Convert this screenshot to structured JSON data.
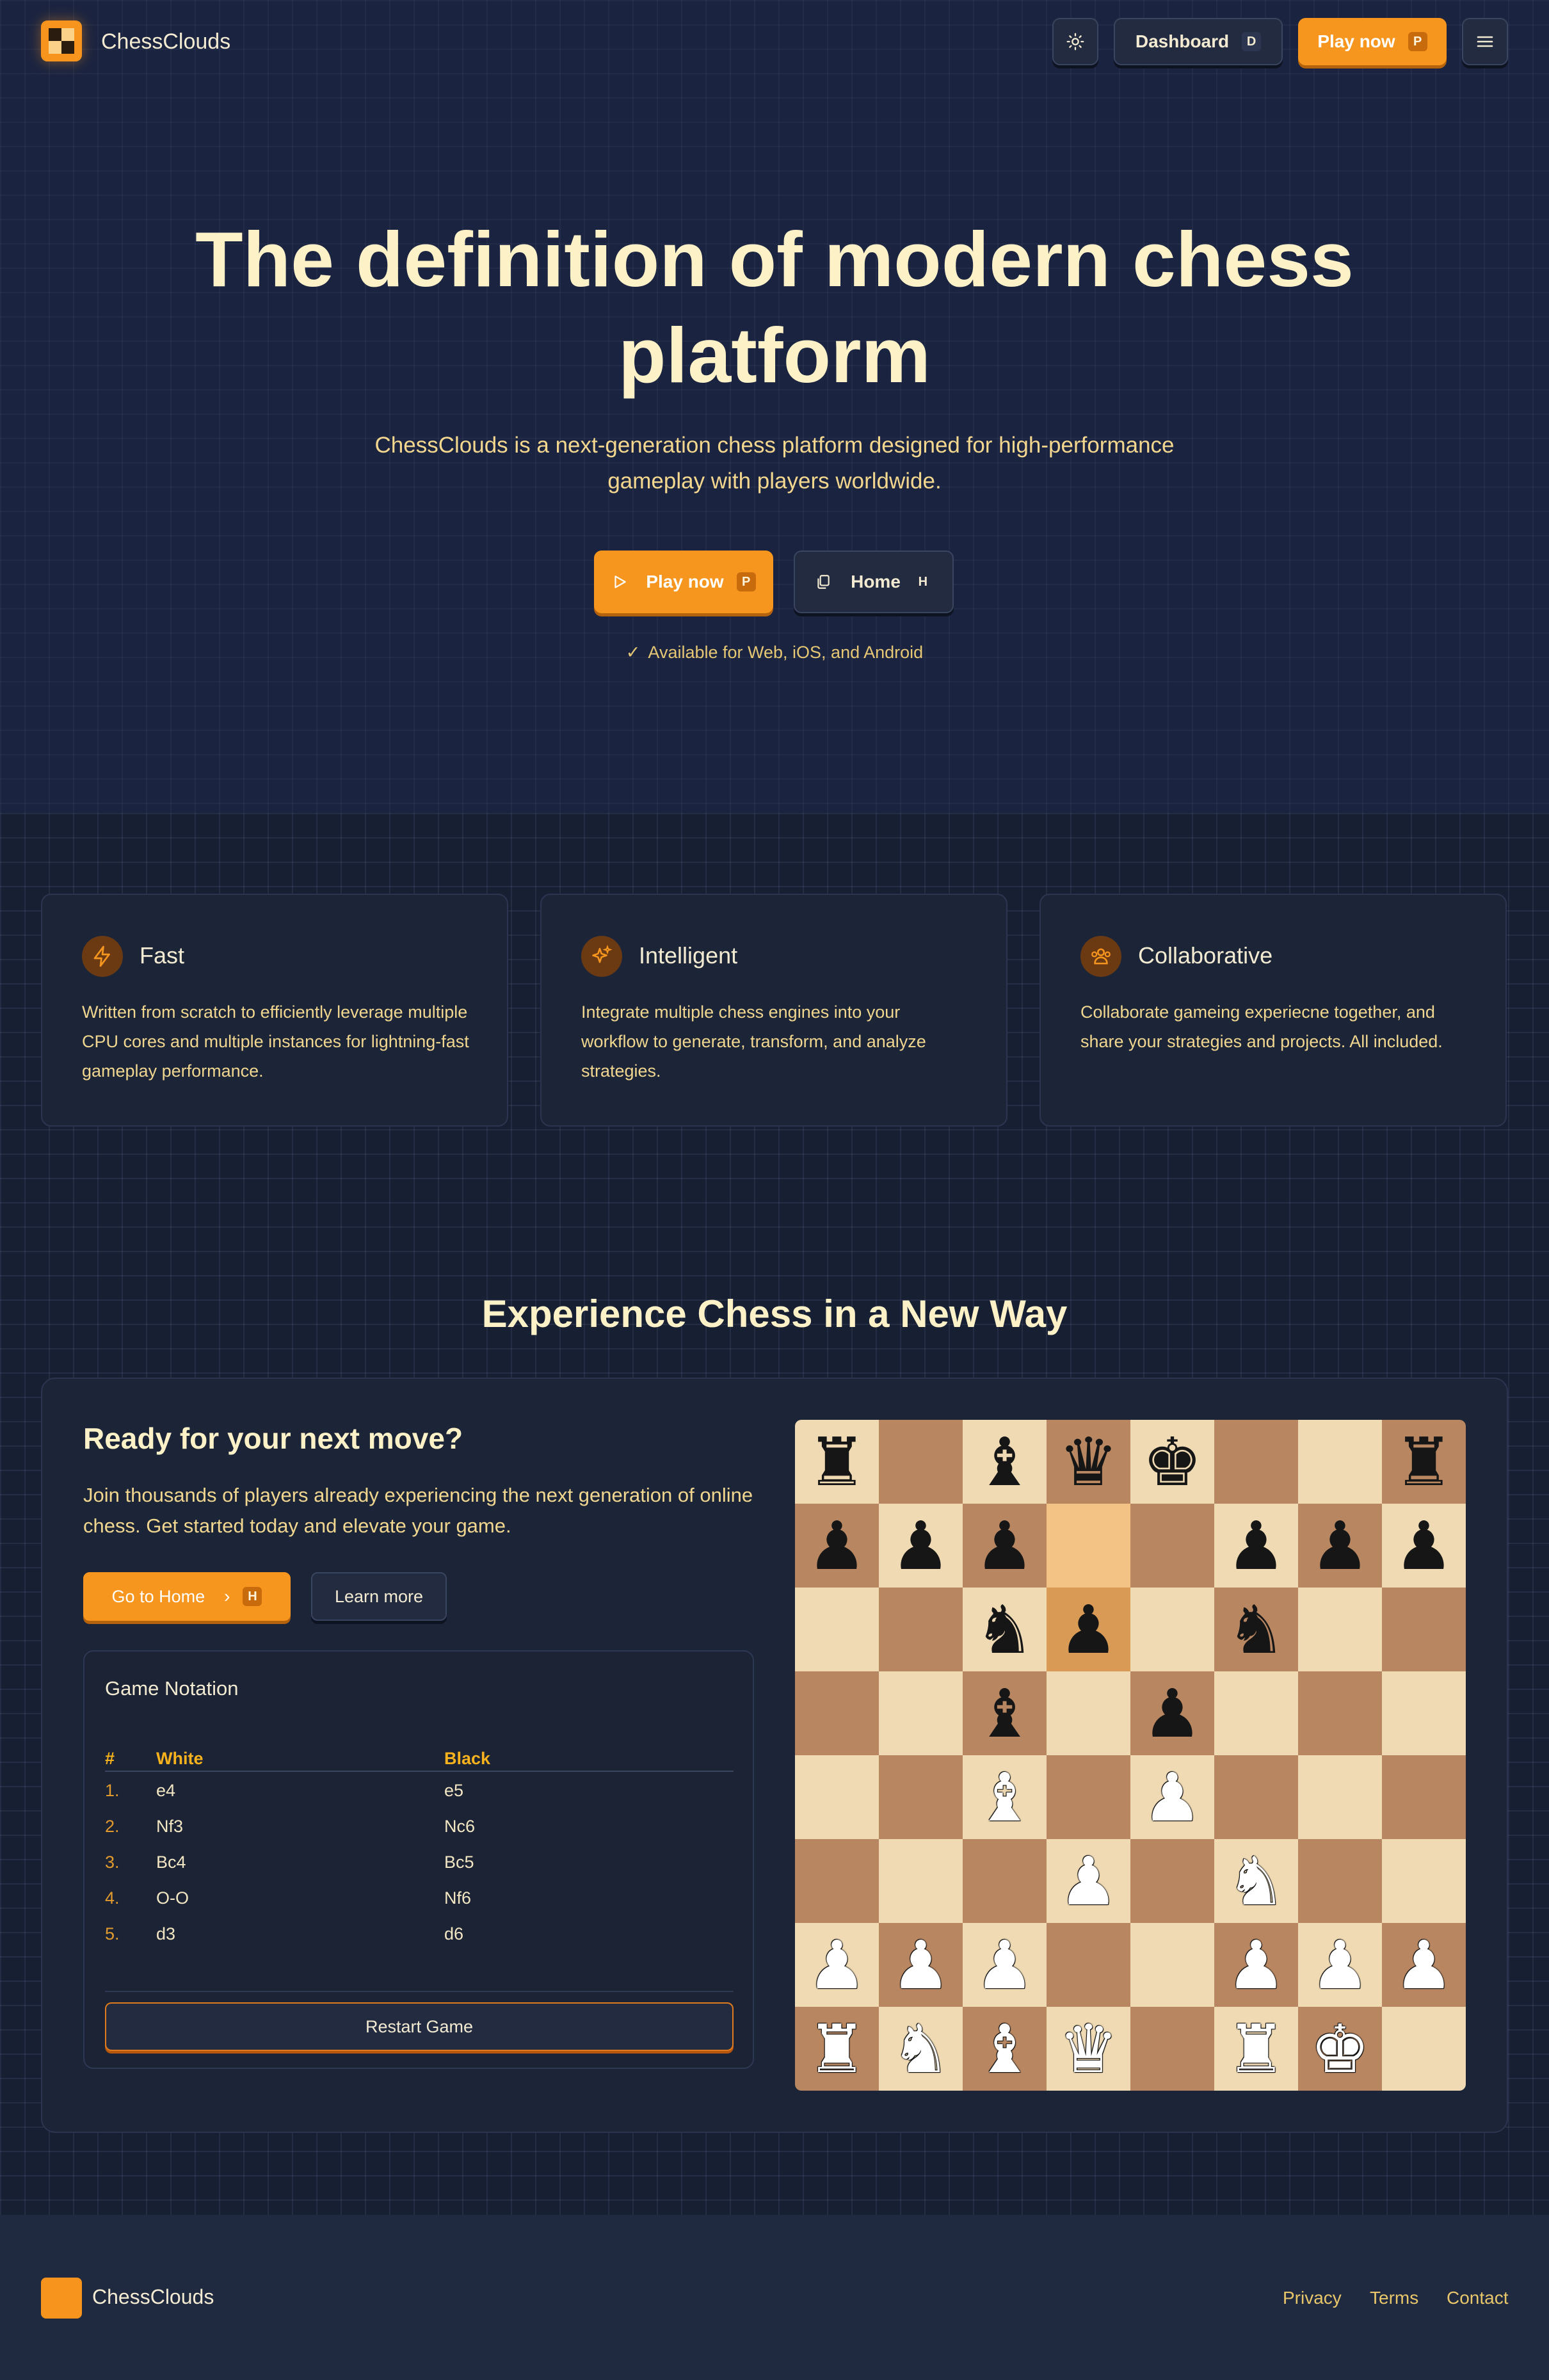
{
  "brand": {
    "name": "ChessClouds"
  },
  "nav": {
    "theme_icon": "sun-icon",
    "dashboard_label": "Dashboard",
    "dashboard_key": "D",
    "play_label": "Play now",
    "play_key": "P",
    "menu_icon": "hamburger-menu-icon"
  },
  "hero": {
    "title_line1": "The definition of modern chess",
    "title_line2": "platform",
    "subtitle_line1": "ChessClouds is a next-generation chess platform designed for high-performance",
    "subtitle_line2": "gameplay with players worldwide.",
    "play_label": "Play now",
    "play_key": "P",
    "home_label": "Home",
    "home_key": "H",
    "available": "Available for Web, iOS, and Android"
  },
  "features": [
    {
      "icon": "lightning-icon",
      "title": "Fast",
      "text": "Written from scratch to efficiently leverage multiple CPU cores and multiple instances for lightning-fast gameplay performance."
    },
    {
      "icon": "sparkles-icon",
      "title": "Intelligent",
      "text": "Integrate multiple chess engines into your workflow to generate, transform, and analyze strategies."
    },
    {
      "icon": "users-icon",
      "title": "Collaborative",
      "text": "Collaborate gameing experiecne together, and share your strategies and projects. All included."
    }
  ],
  "experience": {
    "title": "Experience Chess in a New Way",
    "ready_title": "Ready for your next move?",
    "ready_text": "Join thousands of players already experiencing the next generation of online chess. Get started today and elevate your game.",
    "go_home_label": "Go to Home",
    "go_home_key": "H",
    "learn_more_label": "Learn more"
  },
  "notation": {
    "title": "Game Notation",
    "headers": {
      "num": "#",
      "white": "White",
      "black": "Black"
    },
    "moves": [
      {
        "num": "1.",
        "white": "e4",
        "black": "e5"
      },
      {
        "num": "2.",
        "white": "Nf3",
        "black": "Nc6"
      },
      {
        "num": "3.",
        "white": "Bc4",
        "black": "Bc5"
      },
      {
        "num": "4.",
        "white": "O-O",
        "black": "Nf6"
      },
      {
        "num": "5.",
        "white": "d3",
        "black": "d6"
      }
    ],
    "restart_label": "Restart Game"
  },
  "board": {
    "rows": [
      [
        "r",
        "",
        "b",
        "q",
        "k",
        "",
        "",
        "r"
      ],
      [
        "p",
        "p",
        "p",
        "",
        "",
        "p",
        "p",
        "p"
      ],
      [
        "",
        "",
        "n",
        "p",
        "",
        "n",
        "",
        ""
      ],
      [
        "",
        "",
        "b",
        "",
        "p",
        "",
        "",
        ""
      ],
      [
        "",
        "",
        "B",
        "",
        "P",
        "",
        "",
        ""
      ],
      [
        "",
        "",
        "",
        "P",
        "",
        "N",
        "",
        ""
      ],
      [
        "P",
        "P",
        "P",
        "",
        "",
        "P",
        "P",
        "P"
      ],
      [
        "R",
        "N",
        "B",
        "Q",
        "",
        "R",
        "K",
        ""
      ]
    ],
    "highlighted": [
      "d7",
      "d6"
    ]
  },
  "footer": {
    "brand": "ChessClouds",
    "privacy": "Privacy",
    "terms": "Terms",
    "contact": "Contact"
  },
  "colors": {
    "accent": "#f7961e",
    "background": "#171f33",
    "card": "#1c2538",
    "text_gold": "#f0d68f",
    "board_light": "#efdab4",
    "board_dark": "#b88762"
  }
}
